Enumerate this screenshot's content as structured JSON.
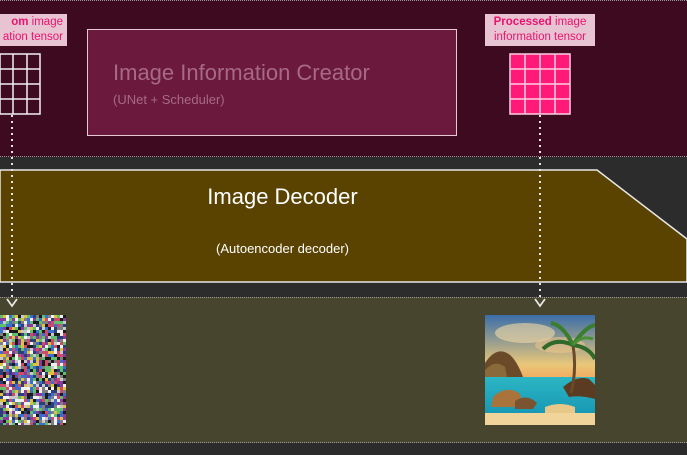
{
  "creator": {
    "title": "Image Information Creator",
    "subtitle": "(UNet + Scheduler)"
  },
  "decoder": {
    "title": "Image Decoder",
    "subtitle": "(Autoencoder decoder)"
  },
  "random_tensor": {
    "label_bold": "om",
    "label_rest": "image",
    "label_line2": "ation tensor"
  },
  "processed_tensor": {
    "label_bold": "Processed",
    "label_rest": "image",
    "label_line2": "information tensor"
  },
  "outputs": {
    "noise_image": "noise-image",
    "decoded_image": "tropical-beach-image"
  },
  "colors": {
    "creator_band": "#3e0a1f",
    "creator_box": "#6b1a3e",
    "decoder": "#5a4300",
    "output_band": "#48452e",
    "accent_pink": "#e8136f",
    "tensor_fill": "#ff1a7a"
  }
}
